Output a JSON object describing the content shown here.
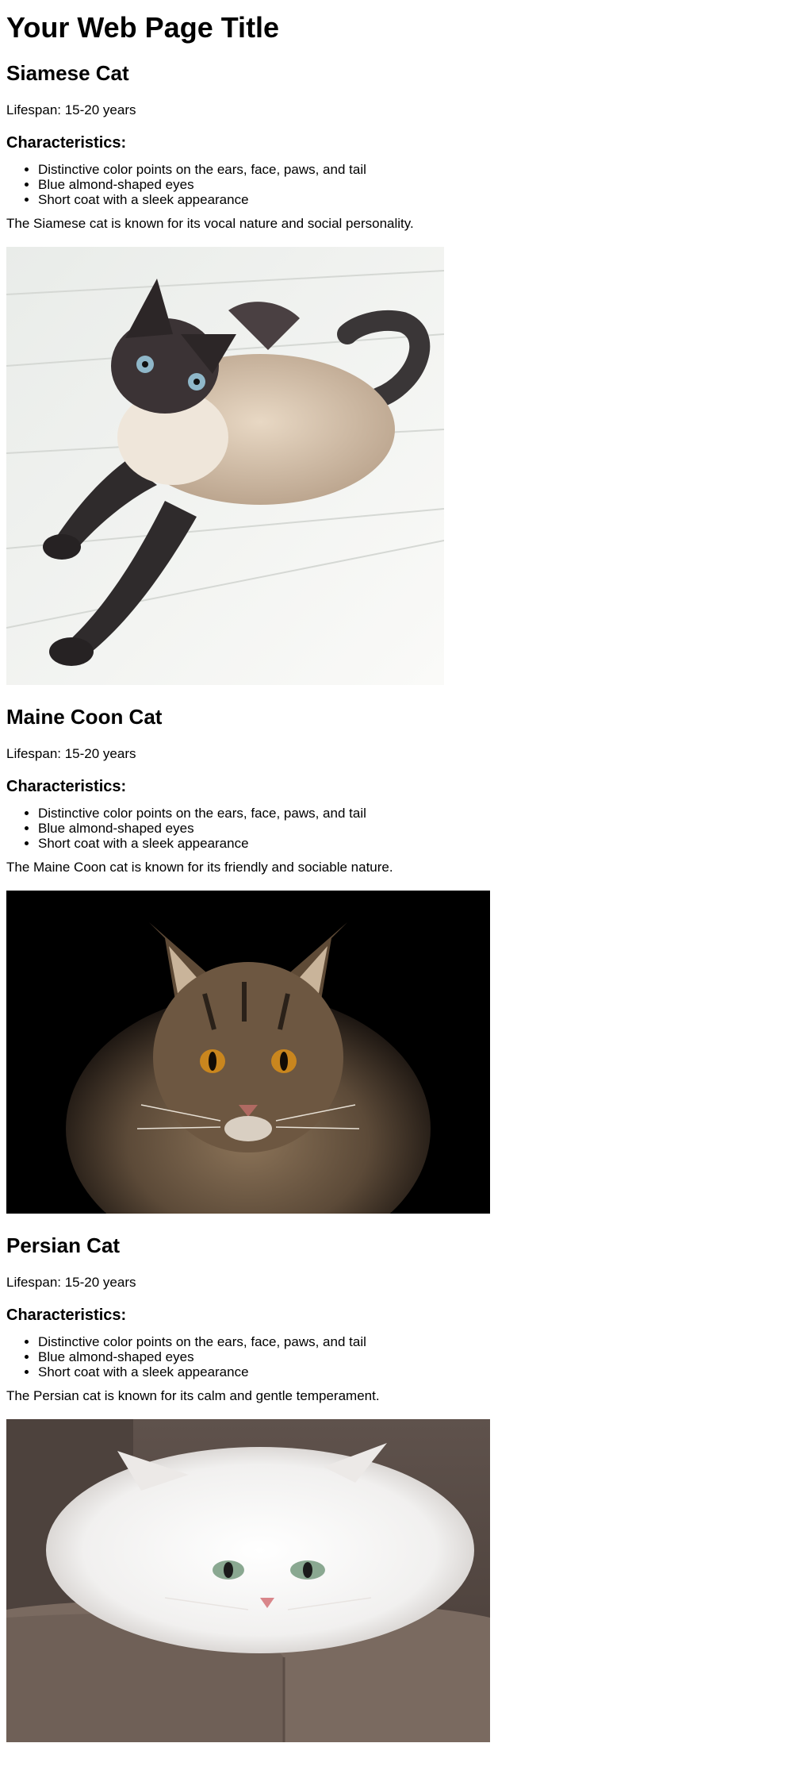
{
  "page": {
    "title": "Your Web Page Title"
  },
  "cats": [
    {
      "name": "Siamese Cat",
      "lifespan": "Lifespan: 15-20 years",
      "characteristics_heading": "Characteristics:",
      "characteristics": [
        "Distinctive color points on the ears, face, paws, and tail",
        "Blue almond-shaped eyes",
        "Short coat with a sleek appearance"
      ],
      "description": "The Siamese cat is known for its vocal nature and social personality.",
      "image": {
        "kind": "siamese-cat-photo",
        "background": "#f4f5f3"
      }
    },
    {
      "name": "Maine Coon Cat",
      "lifespan": "Lifespan: 15-20 years",
      "characteristics_heading": "Characteristics:",
      "characteristics": [
        "Distinctive color points on the ears, face, paws, and tail",
        "Blue almond-shaped eyes",
        "Short coat with a sleek appearance"
      ],
      "description": "The Maine Coon cat is known for its friendly and sociable nature.",
      "image": {
        "kind": "maine-coon-cat-photo",
        "background": "#000000"
      }
    },
    {
      "name": "Persian Cat",
      "lifespan": "Lifespan: 15-20 years",
      "characteristics_heading": "Characteristics:",
      "characteristics": [
        "Distinctive color points on the ears, face, paws, and tail",
        "Blue almond-shaped eyes",
        "Short coat with a sleek appearance"
      ],
      "description": "The Persian cat is known for its calm and gentle temperament.",
      "image": {
        "kind": "persian-cat-photo",
        "background": "#5a4f49"
      }
    }
  ]
}
